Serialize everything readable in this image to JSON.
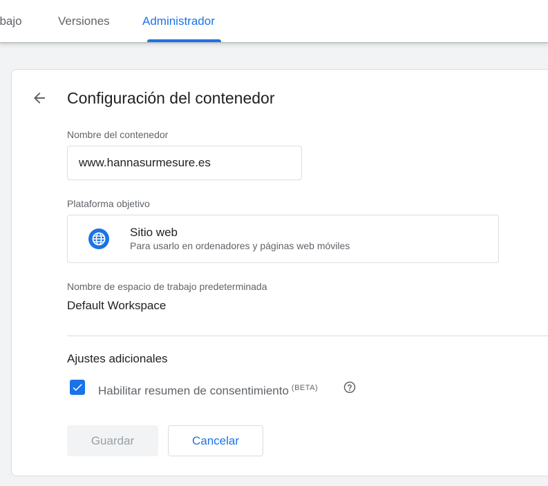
{
  "tabs": [
    {
      "label": "abajo",
      "active": false
    },
    {
      "label": "Versiones",
      "active": false
    },
    {
      "label": "Administrador",
      "active": true
    }
  ],
  "page": {
    "title": "Configuración del contenedor"
  },
  "container_name": {
    "label": "Nombre del contenedor",
    "value": "www.hannasurmesure.es"
  },
  "platform": {
    "label": "Plataforma objetivo",
    "icon": "globe-icon",
    "title": "Sitio web",
    "description": "Para usarlo en ordenadores y páginas web móviles"
  },
  "workspace": {
    "label": "Nombre de espacio de trabajo predeterminada",
    "value": "Default Workspace"
  },
  "additional": {
    "title": "Ajustes adicionales",
    "consent_label": "Habilitar resumen de consentimiento",
    "consent_badge": "(BETA)",
    "consent_checked": true
  },
  "buttons": {
    "save": "Guardar",
    "cancel": "Cancelar"
  },
  "colors": {
    "accent": "#1a73e8",
    "text": "#202124",
    "muted": "#5f6368",
    "border": "#dadce0"
  }
}
